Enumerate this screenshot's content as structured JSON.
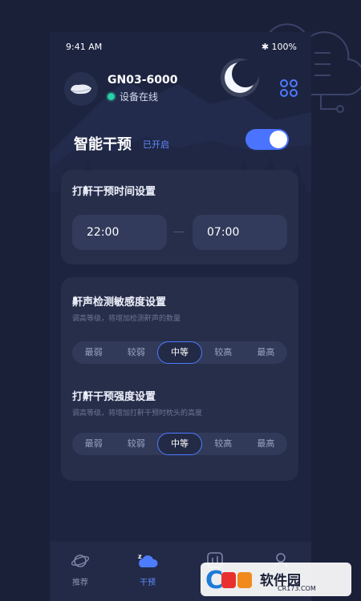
{
  "status_bar": {
    "time": "9:41 AM",
    "battery": "100%"
  },
  "device": {
    "name": "GN03-6000",
    "status": "设备在线"
  },
  "feature": {
    "title": "智能干预",
    "state": "已开启",
    "enabled": true
  },
  "schedule": {
    "title": "打鼾干预时间设置",
    "start": "22:00",
    "end": "07:00"
  },
  "sensitivity": {
    "title": "鼾声检测敏感度设置",
    "subtitle": "调高等级，将增加检测鼾声的数量",
    "options": [
      "最弱",
      "较弱",
      "中等",
      "较高",
      "最高"
    ],
    "selected": "中等"
  },
  "intensity": {
    "title": "打鼾干预强度设置",
    "subtitle": "调高等级，将增加打鼾干预时枕头的高度",
    "options": [
      "最弱",
      "较弱",
      "中等",
      "较高",
      "最高"
    ],
    "selected": "中等"
  },
  "tabs": [
    {
      "label": "推荐",
      "icon": "planet-icon"
    },
    {
      "label": "干预",
      "icon": "sleep-cloud-icon",
      "active": true
    },
    {
      "label": "",
      "icon": "chart-icon"
    },
    {
      "label": "",
      "icon": "profile-icon"
    }
  ],
  "watermark": {
    "text": "软件园",
    "url": "CR173.COM"
  },
  "colors": {
    "accent": "#4a74ff",
    "background": "#1a2038",
    "card": "#262e4a",
    "online": "#27d3a7"
  }
}
